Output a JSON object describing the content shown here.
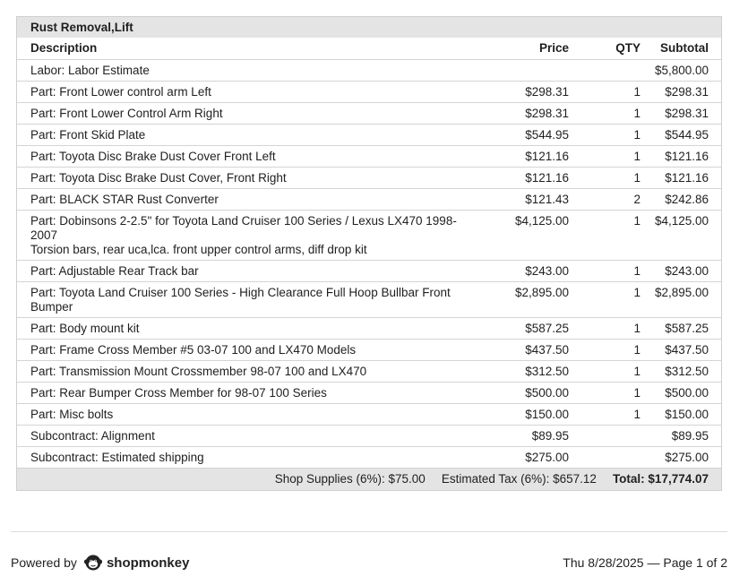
{
  "section": {
    "title": "Rust Removal,Lift"
  },
  "columns": {
    "description": "Description",
    "price": "Price",
    "qty": "QTY",
    "subtotal": "Subtotal"
  },
  "items": [
    {
      "lines": [
        "Labor: Labor Estimate"
      ],
      "price": "",
      "qty": "",
      "subtotal": "$5,800.00"
    },
    {
      "lines": [
        "Part: Front Lower control arm Left"
      ],
      "price": "$298.31",
      "qty": "1",
      "subtotal": "$298.31"
    },
    {
      "lines": [
        "Part: Front Lower Control Arm Right"
      ],
      "price": "$298.31",
      "qty": "1",
      "subtotal": "$298.31"
    },
    {
      "lines": [
        "Part: Front Skid Plate"
      ],
      "price": "$544.95",
      "qty": "1",
      "subtotal": "$544.95"
    },
    {
      "lines": [
        "Part: Toyota  Disc Brake Dust Cover Front Left"
      ],
      "price": "$121.16",
      "qty": "1",
      "subtotal": "$121.16"
    },
    {
      "lines": [
        "Part: Toyota  Disc Brake Dust Cover, Front Right"
      ],
      "price": "$121.16",
      "qty": "1",
      "subtotal": "$121.16"
    },
    {
      "lines": [
        "Part: BLACK STAR Rust Converter"
      ],
      "price": "$121.43",
      "qty": "2",
      "subtotal": "$242.86"
    },
    {
      "lines": [
        "Part: Dobinsons 2-2.5\" for Toyota Land Cruiser 100 Series / Lexus LX470 1998-2007",
        "Torsion bars, rear uca,lca. front upper control arms, diff drop kit"
      ],
      "price": "$4,125.00",
      "qty": "1",
      "subtotal": "$4,125.00"
    },
    {
      "lines": [
        "Part: Adjustable Rear Track bar"
      ],
      "price": "$243.00",
      "qty": "1",
      "subtotal": "$243.00"
    },
    {
      "lines": [
        "Part: Toyota Land Cruiser 100 Series - High Clearance Full Hoop Bullbar Front Bumper"
      ],
      "price": "$2,895.00",
      "qty": "1",
      "subtotal": "$2,895.00"
    },
    {
      "lines": [
        "Part: Body mount kit"
      ],
      "price": "$587.25",
      "qty": "1",
      "subtotal": "$587.25"
    },
    {
      "lines": [
        "Part: Frame Cross Member #5 03-07 100 and LX470 Models"
      ],
      "price": "$437.50",
      "qty": "1",
      "subtotal": "$437.50"
    },
    {
      "lines": [
        "Part: Transmission Mount Crossmember 98-07 100 and LX470"
      ],
      "price": "$312.50",
      "qty": "1",
      "subtotal": "$312.50"
    },
    {
      "lines": [
        "Part: Rear Bumper Cross Member for 98-07 100 Series"
      ],
      "price": "$500.00",
      "qty": "1",
      "subtotal": "$500.00"
    },
    {
      "lines": [
        "Part: Misc bolts"
      ],
      "price": "$150.00",
      "qty": "1",
      "subtotal": "$150.00"
    },
    {
      "lines": [
        "Subcontract: Alignment"
      ],
      "price": "$89.95",
      "qty": "",
      "subtotal": "$89.95"
    },
    {
      "lines": [
        "Subcontract: Estimated shipping"
      ],
      "price": "$275.00",
      "qty": "",
      "subtotal": "$275.00"
    }
  ],
  "totals": {
    "shop_supplies": "Shop Supplies (6%): $75.00",
    "estimated_tax": "Estimated Tax (6%): $657.12",
    "total": "Total: $17,774.07"
  },
  "footer": {
    "powered_by": "Powered by",
    "brand": "shopmonkey",
    "brand_icon": "monkey-logo-icon",
    "page_info": "Thu 8/28/2025 — Page 1 of 2"
  }
}
